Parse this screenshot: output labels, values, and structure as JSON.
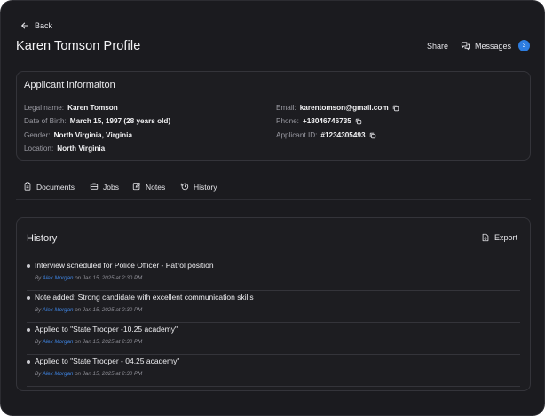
{
  "header": {
    "back_label": "Back",
    "title": "Karen Tomson Profile",
    "share_label": "Share",
    "messages_label": "Messages",
    "messages_count": "3"
  },
  "applicant": {
    "title": "Applicant informaiton",
    "legal_name_label": "Legal name:",
    "legal_name": "Karen Tomson",
    "dob_label": "Date of Birth:",
    "dob": "March 15, 1997 (28 years old)",
    "gender_label": "Gender:",
    "gender": "North Virginia, Virginia",
    "location_label": "Location:",
    "location": "North Virginia",
    "email_label": "Email:",
    "email": "karentomson@gmail.com",
    "phone_label": "Phone:",
    "phone": "+18046746735",
    "applicant_id_label": "Applicant ID:",
    "applicant_id": "#1234305493"
  },
  "tabs": [
    {
      "label": "Documents",
      "icon": "clipboard-icon"
    },
    {
      "label": "Jobs",
      "icon": "briefcase-icon"
    },
    {
      "label": "Notes",
      "icon": "edit-note-icon"
    },
    {
      "label": "History",
      "icon": "history-icon",
      "active": true
    }
  ],
  "history": {
    "title": "History",
    "export_label": "Export",
    "entries": [
      {
        "text": "Interview scheduled for Police Officer - Patrol position",
        "by": "By",
        "author": "Alex Morgan",
        "when": "on Jan 15, 2025 at 2:30 PM"
      },
      {
        "text": "Note added: Strong candidate with excellent communication skills",
        "by": "By",
        "author": "Alex Morgan",
        "when": "on Jan 15, 2025 at 2:30 PM"
      },
      {
        "text": "Applied to \"State Trooper -10.25 academy\"",
        "by": "By",
        "author": "Alex Morgan",
        "when": "on Jan 15, 2025 at 2:30 PM"
      },
      {
        "text": "Applied to \"State Trooper - 04.25 academy\"",
        "by": "By",
        "author": "Alex Morgan",
        "when": "on Jan 15, 2025 at 2:30 PM"
      }
    ]
  },
  "colors": {
    "background": "#1b1b1f",
    "accent": "#2d7de0",
    "author_link": "#3f86e6"
  }
}
